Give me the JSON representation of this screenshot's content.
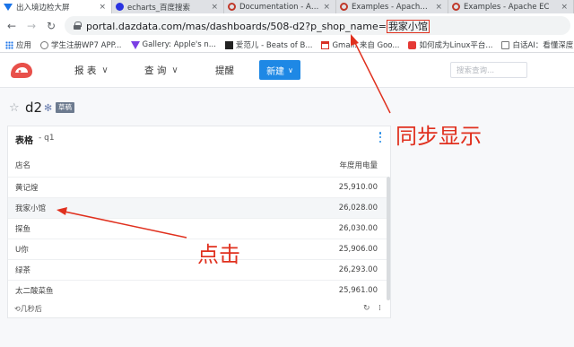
{
  "browser": {
    "tabs": [
      {
        "title": "出入境边检大屏",
        "favicon_color": "#1a73e8"
      },
      {
        "title": "echarts_百度搜索",
        "favicon_color": "#2932e1"
      },
      {
        "title": "Documentation - Apac",
        "favicon_color": "#c0392b"
      },
      {
        "title": "Examples - Apache EC",
        "favicon_color": "#c0392b"
      },
      {
        "title": "Examples - Apache EC",
        "favicon_color": "#c0392b"
      }
    ],
    "url_prefix": "portal.dazdata.com/mas/dashboards/508-d2?p_shop_name=",
    "url_param_value": "我家小馆",
    "bookmarks": [
      {
        "label": "应用",
        "icon": "apps-grid-icon"
      },
      {
        "label": "学生注册WP7 APP...",
        "icon": "globe-icon"
      },
      {
        "label": "Gallery: Apple's n...",
        "icon": "purple-v-icon"
      },
      {
        "label": "爱范儿 - Beats of B...",
        "icon": "ifanr-icon"
      },
      {
        "label": "Gmail: 来自 Goo...",
        "icon": "gmail-icon"
      },
      {
        "label": "如何成为Linux平台...",
        "icon": "red-s-icon"
      },
      {
        "label": "白话AI：看懂深度...",
        "icon": "bookmark-icon"
      }
    ]
  },
  "header": {
    "menu": [
      {
        "label": "报 表"
      },
      {
        "label": "查 询"
      },
      {
        "label": "提醒"
      }
    ],
    "new_button": "新建",
    "search_placeholder": "搜索查询..."
  },
  "dashboard": {
    "title": "d2",
    "badge": "草稿"
  },
  "widget": {
    "title": "表格",
    "subtitle": "- q1",
    "columns": {
      "name": "店名",
      "value": "年度用电量"
    },
    "rows": [
      {
        "name": "黄记煌",
        "value": "25,910.00"
      },
      {
        "name": "我家小馆",
        "value": "26,028.00"
      },
      {
        "name": "探鱼",
        "value": "26,030.00"
      },
      {
        "name": "U你",
        "value": "25,906.00"
      },
      {
        "name": "绿茶",
        "value": "26,293.00"
      },
      {
        "name": "太二酸菜鱼",
        "value": "25,961.00"
      }
    ],
    "refreshed": "几秒后"
  },
  "annotations": {
    "sync_label": "同步显示",
    "click_label": "点击",
    "color": "#e0301e"
  }
}
